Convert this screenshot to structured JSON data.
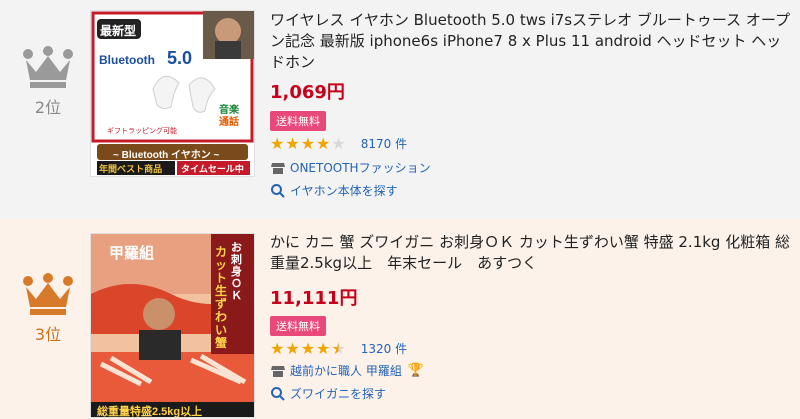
{
  "items": [
    {
      "rank_label": "2位",
      "title": "ワイヤレス イヤホン Bluetooth 5.0 tws i7sステレオ ブルートゥース オープン記念 最新版 iphone6s iPhone7 8 x Plus 11 android ヘッドセット ヘッドホン",
      "price": "1,069円",
      "badge": "送料無料",
      "rating": 4,
      "reviews": "8170 件",
      "shop": "ONETOOTHファッション",
      "search_link": "イヤホン本体を探す",
      "thumb": {
        "tag": "最新型",
        "bt": "Bluetooth",
        "bt_ver": "5.0",
        "side1": "音楽",
        "side2": "通話",
        "gift": "ギフトラッピング可能",
        "band": "~ Bluetooth イヤホン ~",
        "left_badge": "年間ベスト商品",
        "right_badge": "タイムセール中"
      }
    },
    {
      "rank_label": "3位",
      "title": "かに カニ 蟹 ズワイガニ お刺身ＯＫ カット生ずわい蟹 特盛 2.1kg 化粧箱 総重量2.5kg以上　年末セール　あすつく",
      "price": "11,111円",
      "badge": "送料無料",
      "rating": 4.5,
      "reviews": "1320 件",
      "shop": "越前かに職人 甲羅組",
      "search_link": "ズワイガニを探す",
      "thumb": {
        "logo": "甲羅組",
        "vertical1": "お刺身ＯＫ",
        "vertical2": "カット生ずわい蟹",
        "bottom": "総重量特盛2.5kg以上"
      }
    }
  ],
  "colors": {
    "price": "#c4001a",
    "badge": "#e8497a",
    "link": "#2464b4",
    "star": "#f0a500",
    "crown_silver": "#9a9a9a",
    "crown_bronze": "#d77b2a"
  }
}
